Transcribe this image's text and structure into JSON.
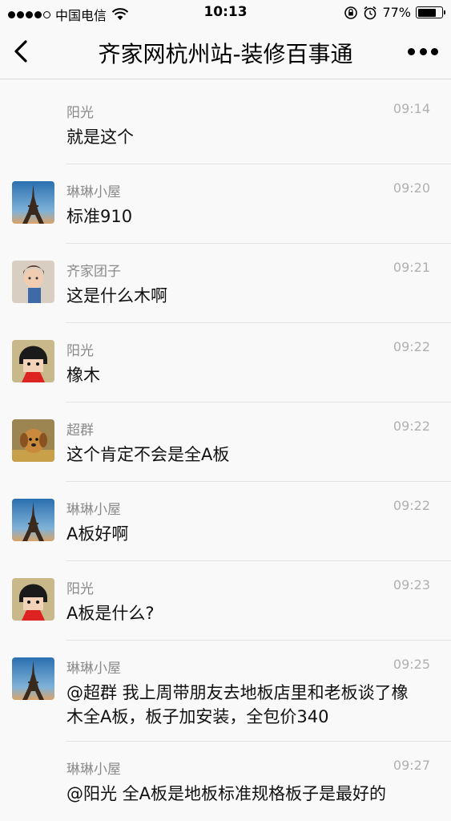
{
  "status_bar": {
    "carrier": "中国电信",
    "time": "10:13",
    "battery_text": "77%",
    "battery_level": 0.77
  },
  "nav": {
    "title": "齐家网杭州站-装修百事通",
    "back_icon": "chevron-left-icon",
    "more_icon": "more-horizontal-icon"
  },
  "messages": [
    {
      "sender": "阳光",
      "time": "09:14",
      "text": "就是这个",
      "avatar": "none"
    },
    {
      "sender": "琳琳小屋",
      "time": "09:20",
      "text": "标准910",
      "avatar": "eiffel-tower"
    },
    {
      "sender": "齐家团子",
      "time": "09:21",
      "text": "这是什么木啊",
      "avatar": "child-photo"
    },
    {
      "sender": "阳光",
      "time": "09:22",
      "text": "橡木",
      "avatar": "cartoon-girl"
    },
    {
      "sender": "超群",
      "time": "09:22",
      "text": "这个肯定不会是全A板",
      "avatar": "puppy"
    },
    {
      "sender": "琳琳小屋",
      "time": "09:22",
      "text": "A板好啊",
      "avatar": "eiffel-tower"
    },
    {
      "sender": "阳光",
      "time": "09:23",
      "text": "A板是什么?",
      "avatar": "cartoon-girl"
    },
    {
      "sender": "琳琳小屋",
      "time": "09:25",
      "text": "@超群 我上周带朋友去地板店里和老板谈了橡木全A板，板子加安装，全包价340",
      "avatar": "eiffel-tower"
    },
    {
      "sender": "琳琳小屋",
      "time": "09:27",
      "text": "@阳光 全A板是地板标准规格板子是最好的",
      "avatar": "none"
    }
  ]
}
